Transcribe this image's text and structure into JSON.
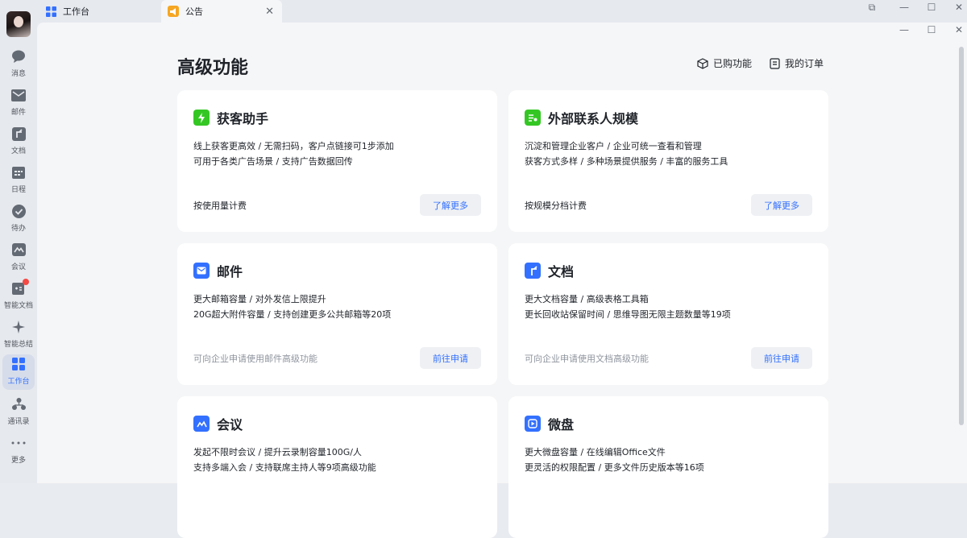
{
  "sidebar": {
    "items": [
      {
        "label": "消息",
        "icon": "chat-bubble-icon"
      },
      {
        "label": "邮件",
        "icon": "mail-icon"
      },
      {
        "label": "文档",
        "icon": "docs-icon"
      },
      {
        "label": "日程",
        "icon": "calendar-icon"
      },
      {
        "label": "待办",
        "icon": "check-circle-icon"
      },
      {
        "label": "会议",
        "icon": "meeting-icon"
      },
      {
        "label": "智能文档",
        "icon": "smart-doc-icon"
      },
      {
        "label": "智能总结",
        "icon": "sparkle-icon"
      },
      {
        "label": "工作台",
        "icon": "workbench-icon"
      },
      {
        "label": "通讯录",
        "icon": "contacts-icon"
      },
      {
        "label": "更多",
        "icon": "more-icon"
      }
    ]
  },
  "tabs": [
    {
      "label": "工作台"
    },
    {
      "label": "公告"
    }
  ],
  "page": {
    "title": "高级功能",
    "purchased_label": "已购功能",
    "orders_label": "我的订单"
  },
  "cards": [
    {
      "title": "获客助手",
      "line1": "线上获客更高效 / 无需扫码，客户点链接可1步添加",
      "line2": "可用于各类广告场景 / 支持广告数据回传",
      "footer": "按使用量计费",
      "button": "了解更多",
      "icon_color": "#34c724"
    },
    {
      "title": "外部联系人规模",
      "line1": "沉淀和管理企业客户 / 企业可统一查看和管理",
      "line2": "获客方式多样 / 多种场景提供服务 / 丰富的服务工具",
      "footer": "按规模分档计费",
      "button": "了解更多",
      "icon_color": "#34c724"
    },
    {
      "title": "邮件",
      "line1": "更大邮箱容量 / 对外发信上限提升",
      "line2": "20G超大附件容量 / 支持创建更多公共邮箱等20项",
      "footer": "可向企业申请使用邮件高级功能",
      "button": "前往申请",
      "icon_color": "#3370ff"
    },
    {
      "title": "文档",
      "line1": "更大文档容量 / 高级表格工具箱",
      "line2": "更长回收站保留时间 / 思维导图无限主题数量等19项",
      "footer": "可向企业申请使用文档高级功能",
      "button": "前往申请",
      "icon_color": "#3370ff"
    },
    {
      "title": "会议",
      "line1": "发起不限时会议 / 提升云录制容量100G/人",
      "line2": "支持多端入会 / 支持联席主持人等9项高级功能",
      "footer": "",
      "button": "",
      "icon_color": "#3370ff"
    },
    {
      "title": "微盘",
      "line1": "更大微盘容量 / 在线编辑Office文件",
      "line2": "更灵活的权限配置 / 更多文件历史版本等16项",
      "footer": "",
      "button": "",
      "icon_color": "#3370ff"
    }
  ]
}
